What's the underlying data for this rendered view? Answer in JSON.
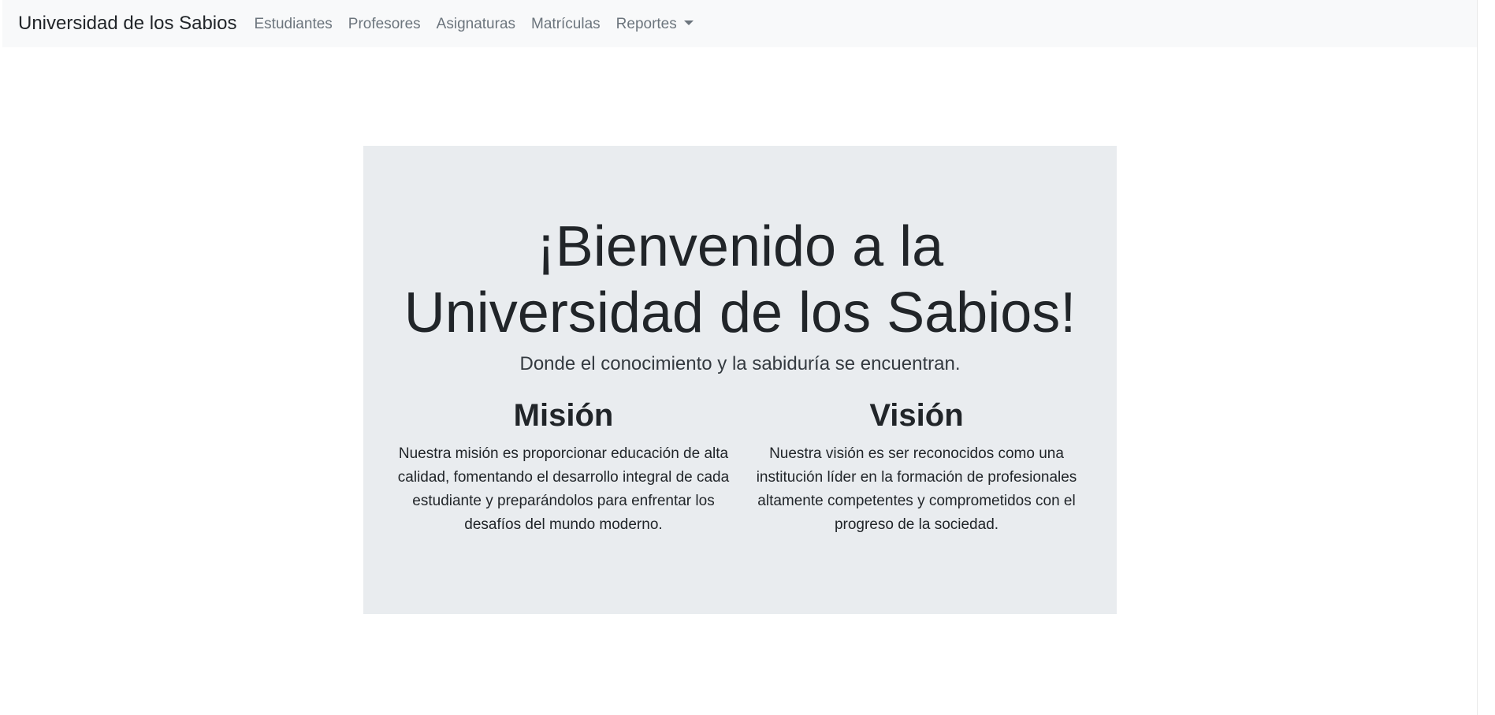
{
  "navbar": {
    "brand": "Universidad de los Sabios",
    "links": [
      {
        "label": "Estudiantes"
      },
      {
        "label": "Profesores"
      },
      {
        "label": "Asignaturas"
      },
      {
        "label": "Matrículas"
      }
    ],
    "dropdown": {
      "label": "Reportes"
    }
  },
  "hero": {
    "title": "¡Bienvenido a la Universidad de los Sabios!",
    "subtitle": "Donde el conocimiento y la sabiduría se encuentran."
  },
  "mission": {
    "heading": "Misión",
    "text": "Nuestra misión es proporcionar educación de alta calidad, fomentando el desarrollo integral de cada estudiante y preparándolos para enfrentar los desafíos del mundo moderno."
  },
  "vision": {
    "heading": "Visión",
    "text": "Nuestra visión es ser reconocidos como una institución líder en la formación de profesionales altamente competentes y comprometidos con el progreso de la sociedad."
  },
  "colors": {
    "navbar_bg": "#f8f9fa",
    "jumbotron_bg": "#e9ecef",
    "text": "#212529",
    "nav_link": "#6c757d"
  }
}
